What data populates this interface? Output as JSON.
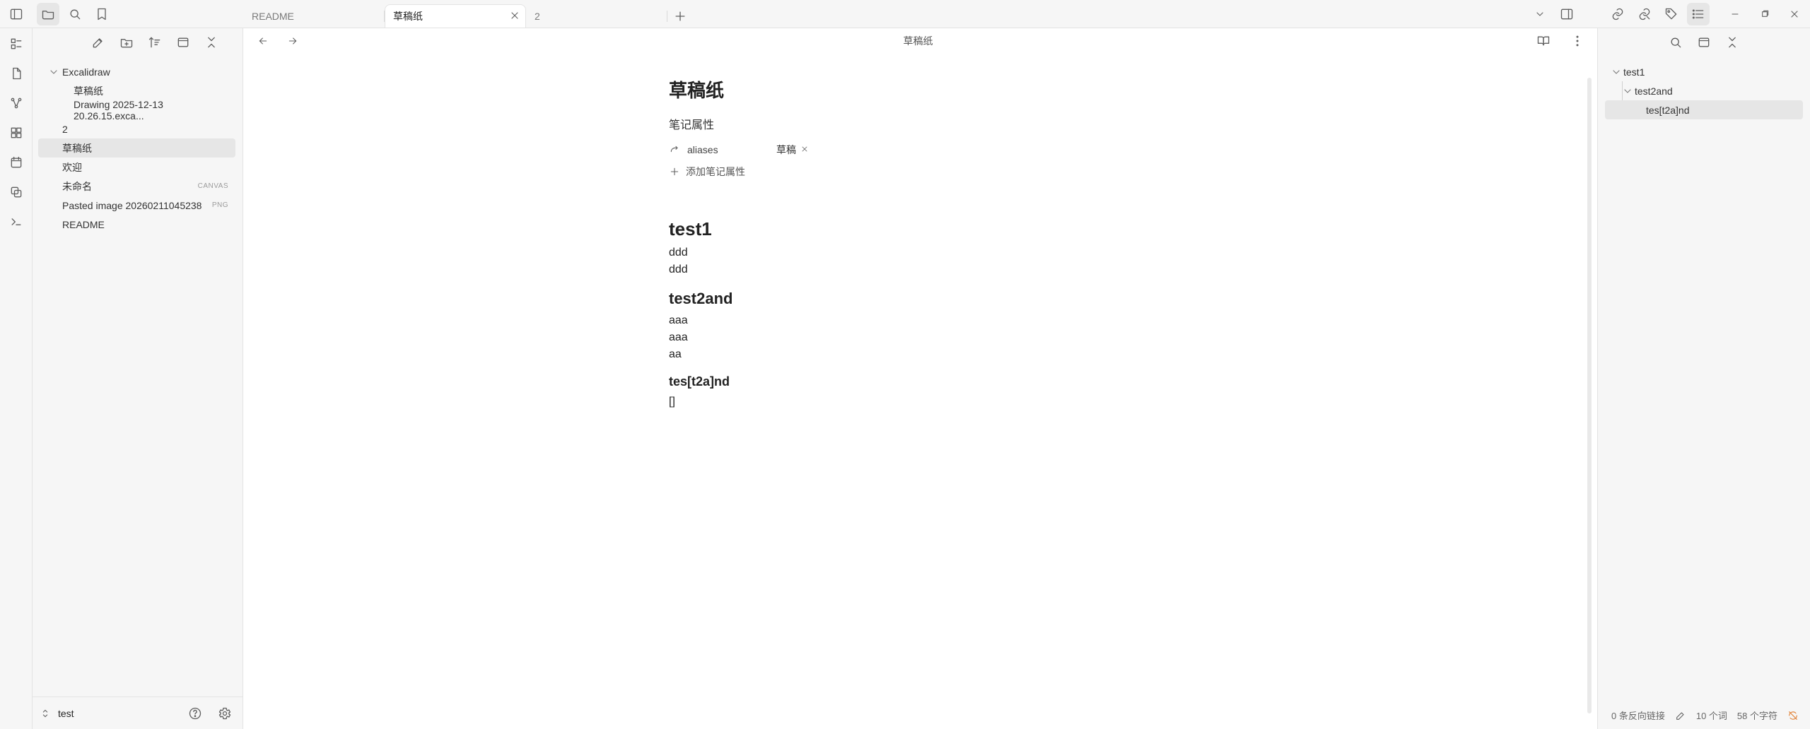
{
  "left_sidebar": {
    "tree": [
      {
        "label": "Excalidraw",
        "type": "folder",
        "expanded": true
      },
      {
        "label": "草稿纸",
        "type": "file",
        "level": 1
      },
      {
        "label": "Drawing 2025-12-13 20.26.15.exca...",
        "type": "file",
        "level": 1
      },
      {
        "label": "2",
        "type": "file"
      },
      {
        "label": "草稿纸",
        "type": "file",
        "active": true
      },
      {
        "label": "欢迎",
        "type": "file"
      },
      {
        "label": "未命名",
        "type": "file",
        "badge": "CANVAS"
      },
      {
        "label": "Pasted image 20260211045238",
        "type": "file",
        "badge": "PNG"
      },
      {
        "label": "README",
        "type": "file"
      }
    ],
    "vault_name": "test"
  },
  "tabs": [
    {
      "label": "README"
    },
    {
      "label": "草稿纸",
      "active": true
    },
    {
      "label": "2"
    }
  ],
  "editor": {
    "header_title": "草稿纸",
    "note_title": "草稿纸",
    "properties_heading": "笔记属性",
    "property": {
      "key": "aliases",
      "value": "草稿"
    },
    "add_property": "添加笔记属性",
    "content": {
      "h1": "test1",
      "p1": [
        "ddd",
        "ddd"
      ],
      "h2": "test2and",
      "p2": [
        "aaa",
        "aaa",
        "aa"
      ],
      "h3": "tes[t2a]nd",
      "p3": [
        "[]"
      ]
    }
  },
  "right_sidebar": {
    "outline": [
      {
        "label": "test1",
        "level": 1
      },
      {
        "label": "test2and",
        "level": 2
      },
      {
        "label": "tes[t2a]nd",
        "level": 3
      }
    ]
  },
  "status_bar": {
    "backlinks": "0 条反向链接",
    "words": "10 个词",
    "chars": "58 个字符"
  },
  "colors": {
    "panel": "#f6f6f6",
    "border": "#e3e3e3",
    "active_bg": "#e6e6e6"
  },
  "icons": {
    "sidebar_toggle": "sidebar-toggle-icon",
    "folder": "folder-icon",
    "search": "search-icon",
    "bookmark": "bookmark-icon",
    "new_note": "new-note-icon",
    "new_folder": "new-folder-icon",
    "sort": "sort-icon",
    "collapse": "collapse-icon",
    "close": "close-icon",
    "plus": "plus-icon",
    "chevron_down": "chevron-down-icon",
    "more": "more-vertical-icon"
  }
}
